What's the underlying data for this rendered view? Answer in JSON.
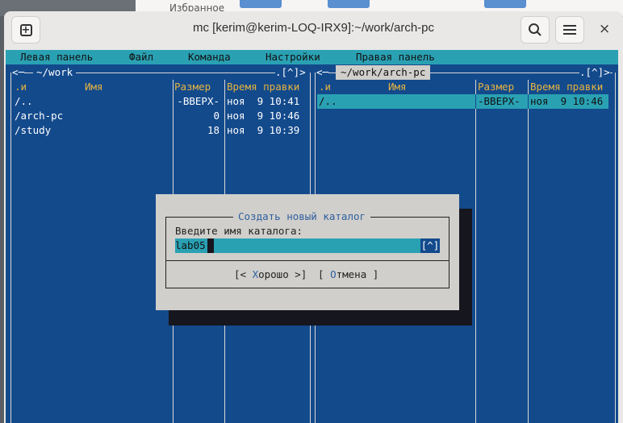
{
  "desktop": {
    "background_window_text": "Избранное"
  },
  "window": {
    "title": "mc [kerim@kerim-LOQ-IRX9]:~/work/arch-pc",
    "new_tab_icon": "plus-square-icon",
    "search_icon": "search-icon",
    "menu_icon": "hamburger-icon",
    "close_label": "×"
  },
  "menubar": [
    "Левая панель",
    "Файл",
    "Команда",
    "Настройки",
    "Правая панель"
  ],
  "left_panel": {
    "path": "~/work",
    "nav_left": "<─",
    "nav_right": ".[^]>",
    "headers": {
      "sort": ".и",
      "name": "Имя",
      "size": "Размер",
      "time": "Время правки"
    },
    "rows": [
      {
        "name": "/..",
        "size": "-ВВЕРХ-",
        "time": "ноя  9 10:41"
      },
      {
        "name": "/arch-pc",
        "size": "0",
        "time": "ноя  9 10:46"
      },
      {
        "name": "/study",
        "size": "18",
        "time": "ноя  9 10:39"
      }
    ]
  },
  "right_panel": {
    "path": "~/work/arch-pc",
    "nav_left": "<─",
    "nav_right": ".[^]>",
    "headers": {
      "sort": ".и",
      "name": "Имя",
      "size": "Размер",
      "time": "Время правки"
    },
    "rows": [
      {
        "name": "/..",
        "size": "-ВВЕРХ-",
        "time": "ноя  9 10:46",
        "selected": true
      }
    ]
  },
  "dialog": {
    "title": "Создать новый каталог",
    "prompt": "Введите имя каталога:",
    "value": "lab05",
    "history": "[^]",
    "ok_pre": "[< ",
    "ok_hot": "Х",
    "ok_rest": "орошо >]",
    "cancel_pre": "[ ",
    "cancel_hot": "О",
    "cancel_rest": "тмена ]"
  },
  "colors": {
    "panel": "#134a8c",
    "accent": "#2aa1b3",
    "header": "#e5b340",
    "dialog": "#d0cfcb"
  }
}
